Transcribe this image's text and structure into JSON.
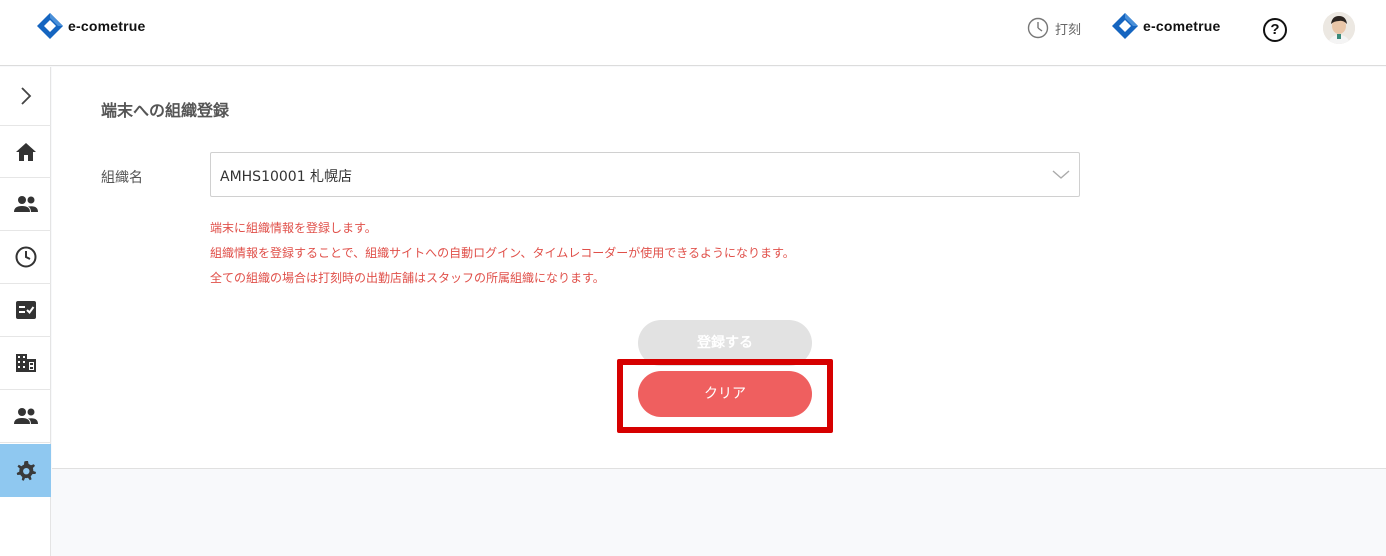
{
  "header": {
    "brand_left": "e-cometrue",
    "clock_label": "打刻",
    "brand_right": "e-cometrue",
    "help_symbol": "?"
  },
  "sidebar": {
    "items": [
      {
        "icon": "home-icon"
      },
      {
        "icon": "people-icon"
      },
      {
        "icon": "clock-icon"
      },
      {
        "icon": "checklist-icon"
      },
      {
        "icon": "building-icon"
      },
      {
        "icon": "group-icon"
      },
      {
        "icon": "gear-icon",
        "active": true
      }
    ]
  },
  "main": {
    "title": "端末への組織登録",
    "org_label": "組織名",
    "org_value": "AMHS10001 札幌店",
    "notes": [
      "端末に組織情報を登録します。",
      "組織情報を登録することで、組織サイトへの自動ログイン、タイムレコーダーが使用できるようになります。",
      "全ての組織の場合は打刻時の出勤店舗はスタッフの所属組織になります。"
    ],
    "register_label": "登録する",
    "clear_label": "クリア"
  },
  "colors": {
    "accent_blue": "#1565c0",
    "note_red": "#e0504a",
    "clear_button": "#ef5f5f",
    "highlight_box": "#d60000",
    "sidebar_active": "#8fc8f0"
  }
}
